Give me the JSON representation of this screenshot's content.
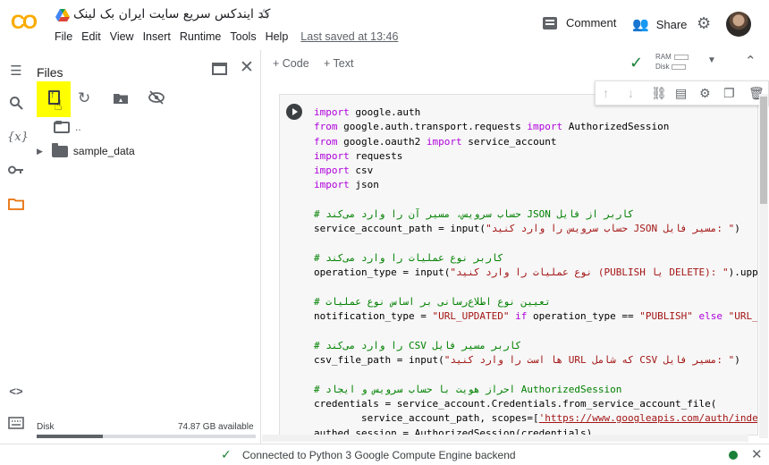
{
  "header": {
    "doc_title": "کد ایندکس سریع سایت ایران بک لینک",
    "menu": [
      "File",
      "Edit",
      "View",
      "Insert",
      "Runtime",
      "Tools",
      "Help"
    ],
    "last_saved": "Last saved at 13:46",
    "comment_label": "Comment",
    "share_label": "Share"
  },
  "brand": {
    "logo_text": "CO",
    "accent": "#f9ab00"
  },
  "files_panel": {
    "title": "Files",
    "parent_label": "..",
    "items": [
      {
        "name": "sample_data"
      }
    ],
    "disk_label": "Disk",
    "disk_available": "74.87 GB available",
    "disk_used_fraction": 0.3
  },
  "toolbar": {
    "add_code": "+ Code",
    "add_text": "+ Text",
    "ram_label": "RAM",
    "disk_label": "Disk"
  },
  "code_lines": [
    [
      [
        "kw",
        "import"
      ],
      [
        "id",
        " google.auth"
      ]
    ],
    [
      [
        "kw",
        "from"
      ],
      [
        "id",
        " google.auth.transport.requests "
      ],
      [
        "kw",
        "import"
      ],
      [
        "id",
        " AuthorizedSession"
      ]
    ],
    [
      [
        "kw",
        "from"
      ],
      [
        "id",
        " google.oauth2 "
      ],
      [
        "kw",
        "import"
      ],
      [
        "id",
        " service_account"
      ]
    ],
    [
      [
        "kw",
        "import"
      ],
      [
        "id",
        " requests"
      ]
    ],
    [
      [
        "kw",
        "import"
      ],
      [
        "id",
        " csv"
      ]
    ],
    [
      [
        "kw",
        "import"
      ],
      [
        "id",
        " json"
      ]
    ],
    [],
    [
      [
        "cm",
        "# حساب سرویس، مسیر آن را وارد می‌کند JSON کاربر از فایل"
      ]
    ],
    [
      [
        "id",
        "service_account_path = input("
      ],
      [
        "str",
        "\"حساب سرویس را وارد کنید JSON مسیر فایل: \""
      ],
      [
        "id",
        ")"
      ]
    ],
    [],
    [
      [
        "cm",
        "# کاربر نوع عملیات را وارد می‌کند"
      ]
    ],
    [
      [
        "id",
        "operation_type = input("
      ],
      [
        "str",
        "\"نوع عملیات را وارد کنید (PUBLISH یا DELETE): \""
      ],
      [
        "id",
        ").upper()"
      ]
    ],
    [],
    [
      [
        "cm",
        "# تعیین نوع اطلاع‌رسانی بر اساس نوع عملیات"
      ]
    ],
    [
      [
        "id",
        "notification_type = "
      ],
      [
        "str",
        "\"URL_UPDATED\""
      ],
      [
        "kw",
        " if"
      ],
      [
        "id",
        " operation_type == "
      ],
      [
        "str",
        "\"PUBLISH\""
      ],
      [
        "kw",
        " else"
      ],
      [
        "str",
        " \"URL_DELETED\""
      ]
    ],
    [],
    [
      [
        "cm",
        "# را وارد می‌کند CSV کاربر مسیر فایل"
      ]
    ],
    [
      [
        "id",
        "csv_file_path = input("
      ],
      [
        "str",
        "\"ها است را وارد کنید URL که شامل CSV مسیر فایل: \""
      ],
      [
        "id",
        ")"
      ]
    ],
    [],
    [
      [
        "cm",
        "# احراز هویت با حساب سرویس و ایجاد AuthorizedSession"
      ]
    ],
    [
      [
        "id",
        "credentials = service_account.Credentials.from_service_account_file("
      ]
    ],
    [
      [
        "id",
        "        service_account_path, scopes=["
      ],
      [
        "url",
        "'https://www.googleapis.com/auth/indexing'"
      ],
      [
        "id",
        "])"
      ]
    ],
    [
      [
        "id",
        "authed_session = AuthorizedSession(credentials)"
      ]
    ]
  ],
  "status": {
    "text": "Connected to Python 3 Google Compute Engine backend"
  }
}
